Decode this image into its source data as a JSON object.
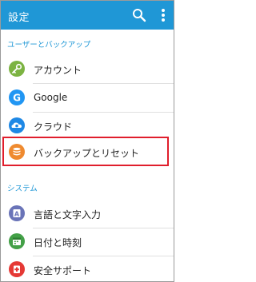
{
  "header": {
    "title": "設定",
    "color": "#1f97d6"
  },
  "sections": [
    {
      "title": "ユーザーとバックアップ",
      "items": [
        {
          "label": "アカウント",
          "icon": "key-icon",
          "color": "#7cb342"
        },
        {
          "label": "Google",
          "icon": "google-g-icon",
          "color": "#2196f3"
        },
        {
          "label": "クラウド",
          "icon": "cloud-icon",
          "color": "#1e88e5"
        },
        {
          "label": "バックアップとリセット",
          "icon": "backup-icon",
          "color": "#ef8a2f",
          "highlighted": true
        }
      ]
    },
    {
      "title": "システム",
      "items": [
        {
          "label": "言語と文字入力",
          "icon": "language-icon",
          "color": "#6a74b8"
        },
        {
          "label": "日付と時刻",
          "icon": "calendar-icon",
          "color": "#43a047"
        },
        {
          "label": "安全サポート",
          "icon": "safety-icon",
          "color": "#e53935"
        }
      ]
    }
  ],
  "highlight_color": "#e01e2c"
}
